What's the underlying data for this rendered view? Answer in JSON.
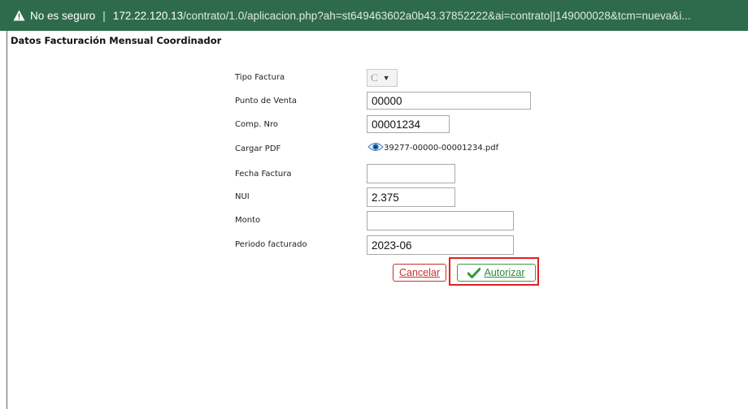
{
  "browser": {
    "security_label": "No es seguro",
    "separator": "|",
    "host": "172.22.120.13",
    "path": "/contrato/1.0/aplicacion.php?ah=st649463602a0b43.37852222&ai=contrato||149000028&tcm=nueva&i..."
  },
  "form": {
    "title": "Datos Facturación Mensual Coordinador",
    "fields": {
      "tipo_factura": {
        "label": "Tipo Factura",
        "value": "C"
      },
      "punto_venta": {
        "label": "Punto de Venta",
        "value": "00000"
      },
      "comp_nro": {
        "label": "Comp. Nro",
        "value": "00001234"
      },
      "cargar_pdf": {
        "label": "Cargar PDF",
        "value": "39277-00000-00001234.pdf"
      },
      "fecha_factura": {
        "label": "Fecha Factura",
        "value": ""
      },
      "nui": {
        "label": "NUI",
        "value": "2.375"
      },
      "monto": {
        "label": "Monto",
        "value": ""
      },
      "periodo": {
        "label": "Periodo facturado",
        "value": "2023-06"
      }
    },
    "buttons": {
      "cancel": "Cancelar",
      "authorize": "Autorizar"
    }
  },
  "colors": {
    "address_bar": "#2e6b4c",
    "cancel": "#c9302c",
    "authorize": "#2d8a3a",
    "highlight": "#e02020"
  },
  "icons": [
    "warning-icon",
    "eye-icon",
    "check-icon",
    "caret-down-icon"
  ]
}
